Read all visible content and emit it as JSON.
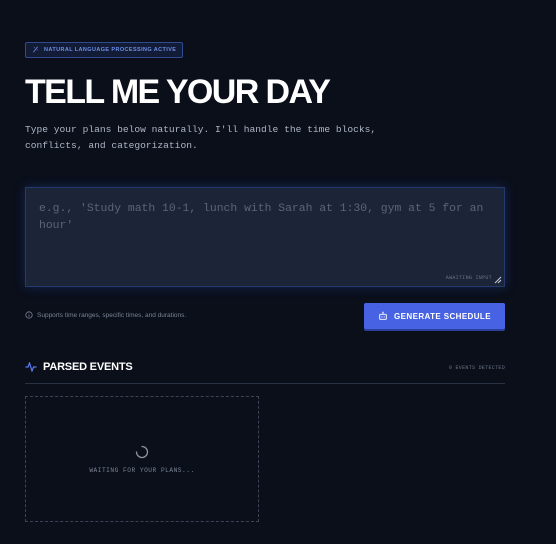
{
  "badge": {
    "label": "NATURAL LANGUAGE PROCESSING ACTIVE",
    "icon": "sparkle-icon"
  },
  "heading": {
    "title": "TELL ME YOUR DAY",
    "subtitle": "Type your plans below naturally. I'll handle the time blocks, conflicts, and categorization."
  },
  "input": {
    "value": "",
    "placeholder": "e.g., 'Study math 10-1, lunch with Sarah at 1:30, gym at 5 for an hour'",
    "status": "AWAITING INPUT"
  },
  "hint": {
    "text": "Supports time ranges, specific times, and durations.",
    "icon": "info-icon"
  },
  "actions": {
    "generate_label": "GENERATE SCHEDULE",
    "generate_icon": "robot-icon"
  },
  "events": {
    "title": "PARSED EVENTS",
    "icon": "activity-icon",
    "count_label": "0 EVENTS DETECTED",
    "empty_text": "WAITING FOR YOUR PLANS..."
  },
  "colors": {
    "background": "#0a0f1a",
    "accent": "#4763e4",
    "input_bg": "#1b2537"
  }
}
